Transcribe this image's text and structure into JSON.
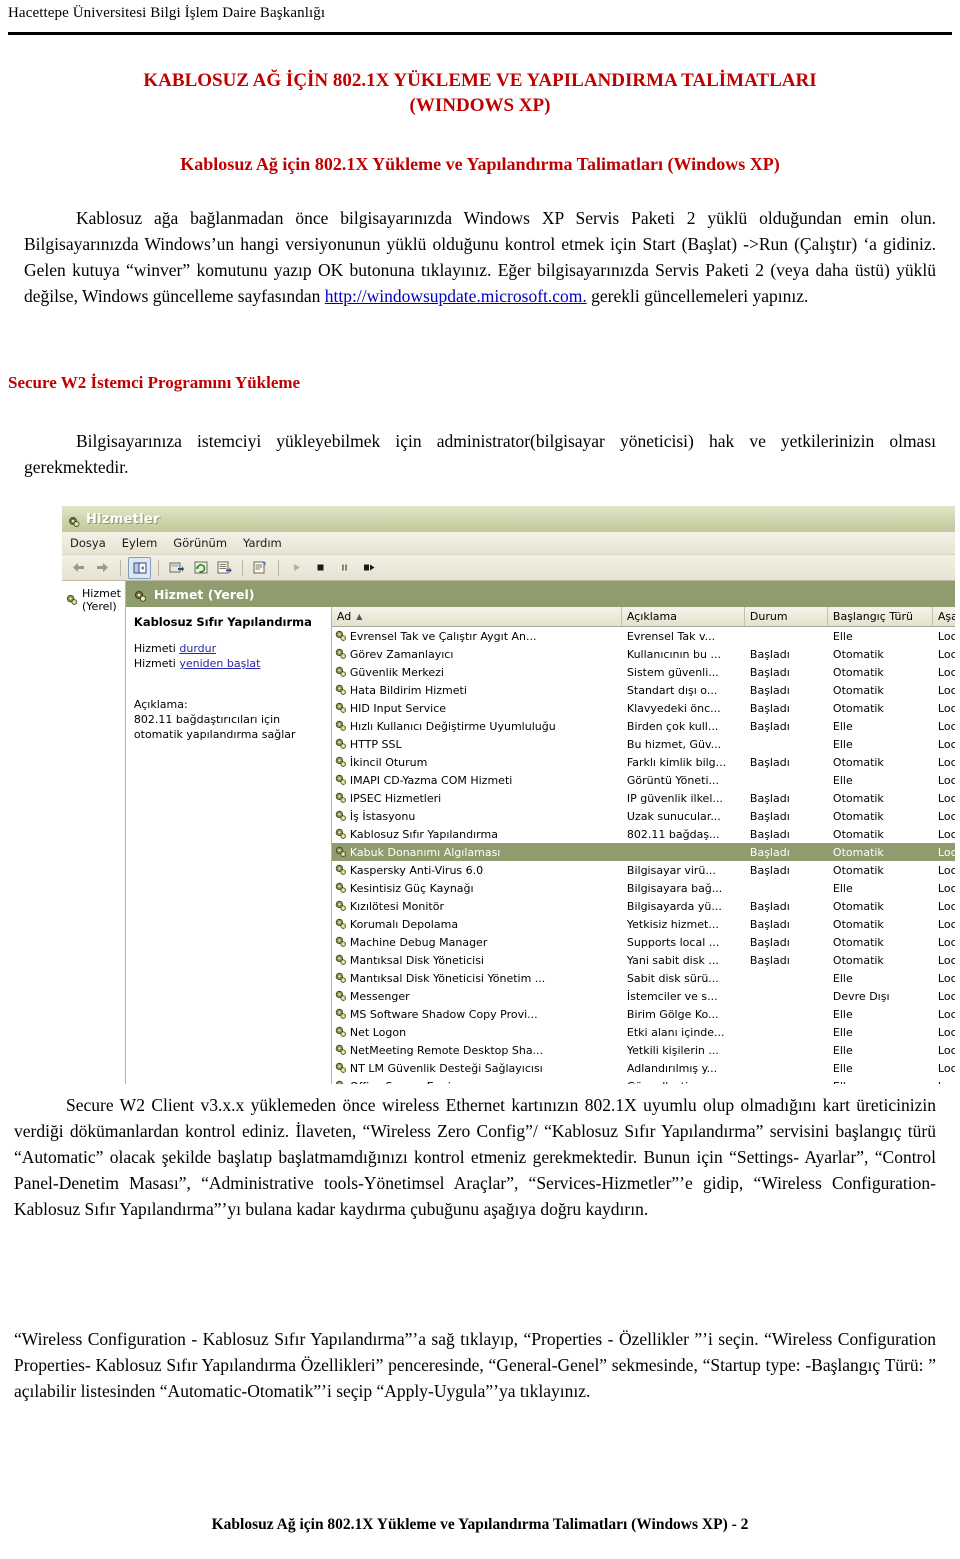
{
  "page_header": {
    "institution": "Hacettepe Üniversitesi Bilgi İşlem Daire Başkanlığı"
  },
  "doc": {
    "title_line1": "KABLOSUZ AĞ İÇİN 802.1X YÜKLEME VE YAPILANDIRMA TALİMATLARI",
    "title_line2": "(WINDOWS XP)",
    "subtitle": "Kablosuz Ağ için 802.1X Yükleme ve Yapılandırma Talimatları (Windows XP)",
    "section_secure_w2": "Secure W2 İstemci Programını Yükleme",
    "footer": "Kablosuz Ağ için 802.1X Yükleme ve Yapılandırma Talimatları (Windows XP) - 2"
  },
  "paragraphs": {
    "p1_a": "Kablosuz ağa bağlanmadan önce bilgisayarınızda Windows XP Servis Paketi 2 yüklü olduğundan emin olun. Bilgisayarınızda Windows’un hangi versiyonunun yüklü olduğunu kontrol etmek için Start (Başlat) ->Run (Çalıştır) ‘a gidiniz. Gelen kutuya “winver” komutunu yazıp OK butonuna tıklayınız. Eğer bilgisayarınızda Servis Paketi 2 (veya daha üstü) yüklü değilse, Windows güncelleme sayfasından ",
    "p1_link": "http://windowsupdate.microsoft.com.",
    "p1_b": " gerekli güncellemeleri yapınız.",
    "p2": "Bilgisayarınıza istemciyi yükleyebilmek için administrator(bilgisayar yöneticisi) hak ve yetkilerinizin olması gerekmektedir.",
    "p3": "Secure W2 Client v3.x.x yüklemeden önce wireless Ethernet kartınızın 802.1X uyumlu olup olmadığını kart üreticinizin verdiği dökümanlardan kontrol ediniz. İlaveten, “Wireless Zero Config”/ “Kablosuz Sıfır Yapılandırma” servisini başlangıç türü “Automatic” olacak şekilde başlatıp başlatmamdığınızı kontrol etmeniz gerekmektedir. Bunun için “Settings- Ayarlar”, “Control Panel-Denetim Masası”, “Administrative tools-Yönetimsel Araçlar”, “Services-Hizmetler”’e gidip,  “Wireless Configuration-Kablosuz Sıfır Yapılandırma”’yı bulana kadar kaydırma çubuğunu aşağıya doğru kaydırın.",
    "p4": "“Wireless Configuration - Kablosuz Sıfır Yapılandırma”’a sağ tıklayıp, “Properties - Özellikler ”’i seçin. “Wireless Configuration Properties- Kablosuz Sıfır Yapılandırma Özellikleri” penceresinde, “General-Genel” sekmesinde, “Startup type: -Başlangıç Türü: ” açılabilir listesinden “Automatic-Otomatik”’i seçip “Apply-Uygula”’ya tıklayınız."
  },
  "services_window": {
    "title": "Hizmetler",
    "menu": [
      "Dosya",
      "Eylem",
      "Görünüm",
      "Yardım"
    ],
    "toolbar_icons": [
      "back-arrow-icon",
      "forward-arrow-icon",
      "show-tree-icon",
      "export-list-icon",
      "refresh-icon",
      "properties-icon",
      "help-icon",
      "start-service-icon",
      "stop-service-icon",
      "pause-service-icon",
      "restart-service-icon"
    ],
    "tree_root": "Hizmet (Yerel)",
    "pane_title": "Hizmet (Yerel)",
    "detail": {
      "service_name": "Kablosuz Sıfır Yapılandırma",
      "action_stop_prefix": "Hizmeti ",
      "action_stop_link": "durdur",
      "action_restart_prefix": "Hizmeti ",
      "action_restart_link": "yeniden başlat",
      "description_label": "Açıklama:",
      "description_text": "802.11 bağdaştırıcıları için otomatik yapılandırma sağlar"
    },
    "columns": [
      "Ad",
      "Açıklama",
      "Durum",
      "Başlangıç Türü",
      "Aşağıdaki Hes..."
    ],
    "sort_indicator": "▲",
    "selected_row_index": 12,
    "rows": [
      [
        "Evrensel Tak ve Çalıştır Aygıt An...",
        "Evrensel Tak v...",
        "",
        "Elle",
        "Local Service"
      ],
      [
        "Görev Zamanlayıcı",
        "Kullanıcının bu ...",
        "Başladı",
        "Otomatik",
        "Local System"
      ],
      [
        "Güvenlik Merkezi",
        "Sistem güvenli...",
        "Başladı",
        "Otomatik",
        "Local System"
      ],
      [
        "Hata Bildirim Hizmeti",
        "Standart dışı o...",
        "Başladı",
        "Otomatik",
        "Local System"
      ],
      [
        "HID Input Service",
        "Klavyedeki önc...",
        "Başladı",
        "Otomatik",
        "Local System"
      ],
      [
        "Hızlı Kullanıcı Değiştirme Uyumluluğu",
        "Birden çok kull...",
        "Başladı",
        "Elle",
        "Local System"
      ],
      [
        "HTTP SSL",
        "Bu hizmet, Güv...",
        "",
        "Elle",
        "Local System"
      ],
      [
        "İkincil Oturum",
        "Farklı kimlik bilg...",
        "Başladı",
        "Otomatik",
        "Local System"
      ],
      [
        "IMAPI CD-Yazma COM Hizmeti",
        "Görüntü Yöneti...",
        "",
        "Elle",
        "Local System"
      ],
      [
        "IPSEC Hizmetleri",
        "IP güvenlik ilkel...",
        "Başladı",
        "Otomatik",
        "Local System"
      ],
      [
        "İş İstasyonu",
        "Uzak sunucular...",
        "Başladı",
        "Otomatik",
        "Local System"
      ],
      [
        "Kablosuz Sıfır Yapılandırma",
        "802.11 bağdaş...",
        "Başladı",
        "Otomatik",
        "Local System"
      ],
      [
        "Kabuk Donanımı Algılaması",
        "",
        "Başladı",
        "Otomatik",
        "Local System"
      ],
      [
        "Kaspersky Anti-Virus 6.0",
        "Bilgisayar virü...",
        "Başladı",
        "Otomatik",
        "Local System"
      ],
      [
        "Kesintisiz Güç Kaynağı",
        "Bilgisayara bağ...",
        "",
        "Elle",
        "Local Service"
      ],
      [
        "Kızılötesi Monitör",
        "Bilgisayarda yü...",
        "Başladı",
        "Otomatik",
        "Local System"
      ],
      [
        "Korumalı Depolama",
        "Yetkisiz hizmet...",
        "Başladı",
        "Otomatik",
        "Local System"
      ],
      [
        "Machine Debug Manager",
        "Supports local ...",
        "Başladı",
        "Otomatik",
        "Local System"
      ],
      [
        "Mantıksal Disk Yöneticisi",
        "Yani sabit disk ...",
        "Başladı",
        "Otomatik",
        "Local System"
      ],
      [
        "Mantıksal Disk Yöneticisi Yönetim ...",
        "Sabit disk sürü...",
        "",
        "Elle",
        "Local System"
      ],
      [
        "Messenger",
        "İstemciler ve s...",
        "",
        "Devre Dışı",
        "Local System"
      ],
      [
        "MS Software Shadow Copy Provi...",
        "Birim Gölge Ko...",
        "",
        "Elle",
        "Local System"
      ],
      [
        "Net Logon",
        "Etki alanı içinde...",
        "",
        "Elle",
        "Local System"
      ],
      [
        "NetMeeting Remote Desktop Sha...",
        "Yetkili kişilerin ...",
        "",
        "Elle",
        "Local System"
      ],
      [
        "NT LM Güvenlik Desteği Sağlayıcısı",
        "Adlandırılmış y...",
        "",
        "Elle",
        "Local System"
      ],
      [
        "Office Source Engine",
        "Güncelleştirme ...",
        "",
        "Elle",
        "Local System"
      ]
    ]
  },
  "colors": {
    "heading_red": "#c00000",
    "xp_green": "#8f9c6d",
    "xp_titlebar": "#ccd2aa",
    "link_blue": "#0000c0"
  }
}
